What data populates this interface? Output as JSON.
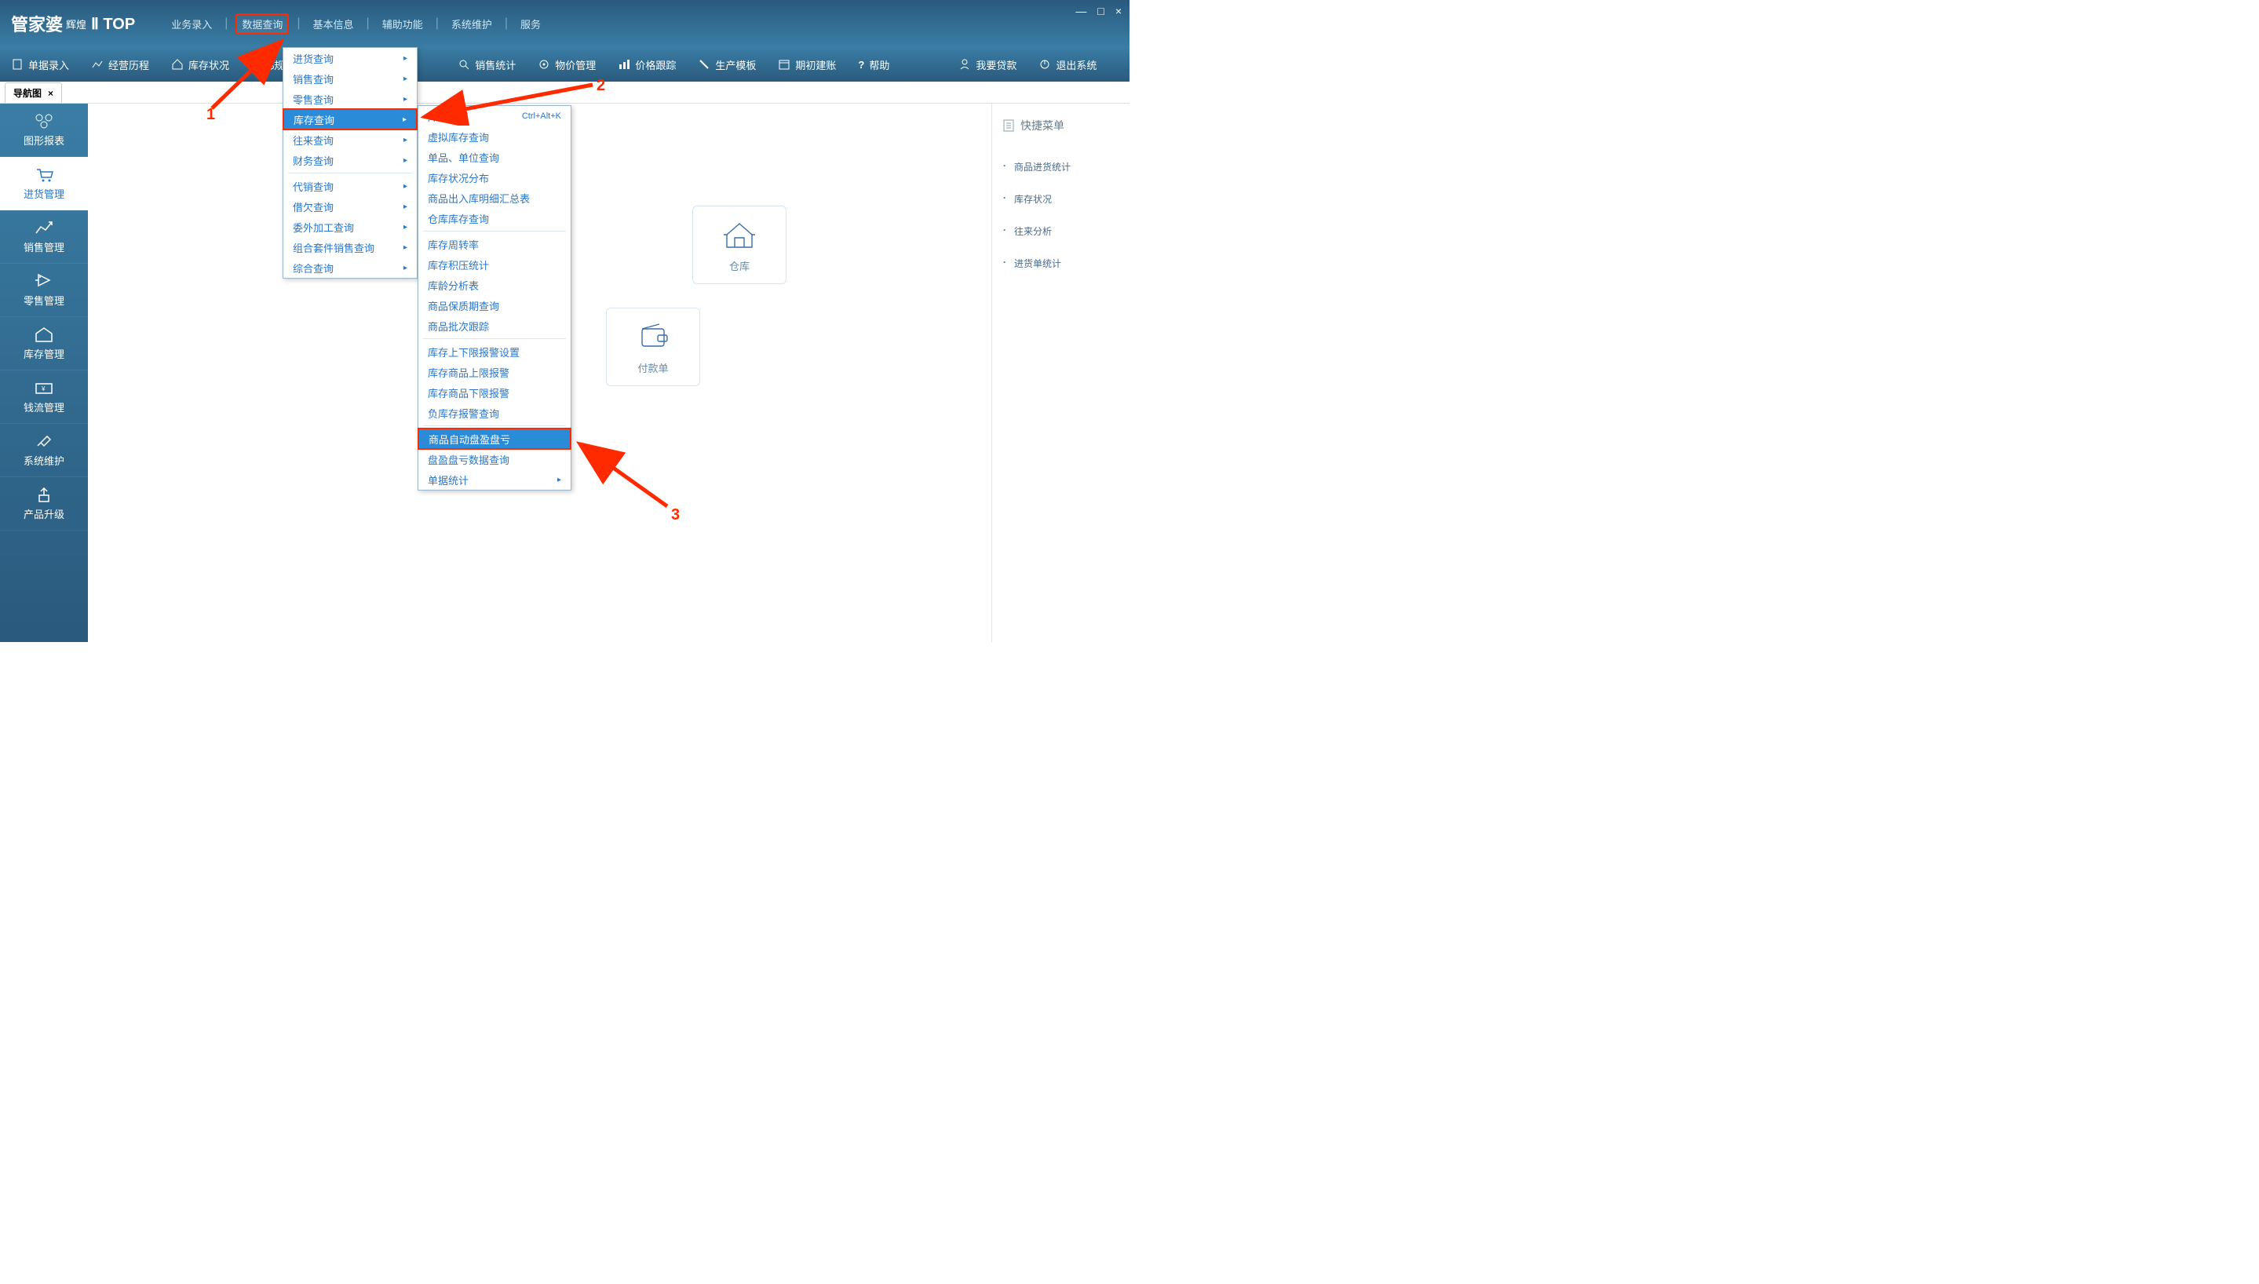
{
  "app_logo": {
    "main": "管家婆",
    "sub": "辉煌",
    "suffix": "Ⅱ TOP"
  },
  "window_controls": {
    "min": "—",
    "max": "□",
    "close": "×"
  },
  "top_menu": {
    "items": [
      "业务录入",
      "数据查询",
      "基本信息",
      "辅助功能",
      "系统维护",
      "服务"
    ],
    "highlighted_index": 1
  },
  "toolbar": [
    {
      "label": "单据录入",
      "icon": "document"
    },
    {
      "label": "经营历程",
      "icon": "chart"
    },
    {
      "label": "库存状况",
      "icon": "home"
    },
    {
      "label": "$规查",
      "icon": "dollar"
    },
    {
      "label": "销售统计",
      "icon": "search"
    },
    {
      "label": "物价管理",
      "icon": "gear"
    },
    {
      "label": "价格跟踪",
      "icon": "bars"
    },
    {
      "label": "生产模板",
      "icon": "wrench"
    },
    {
      "label": "期初建账",
      "icon": "calendar"
    },
    {
      "label": "帮助",
      "icon": "question"
    },
    {
      "label": "我要贷款",
      "icon": "person"
    },
    {
      "label": "退出系统",
      "icon": "power"
    }
  ],
  "tab": {
    "label": "导航图",
    "close": "×"
  },
  "sidebar": [
    {
      "label": "图形报表"
    },
    {
      "label": "进货管理",
      "active": true
    },
    {
      "label": "销售管理"
    },
    {
      "label": "零售管理"
    },
    {
      "label": "库存管理"
    },
    {
      "label": "钱流管理"
    },
    {
      "label": "系统维护"
    },
    {
      "label": "产品升级"
    }
  ],
  "nav_cards": {
    "warehouse": "仓库",
    "payment": "付款单"
  },
  "quick_menu": {
    "title": "快捷菜单",
    "items": [
      "商品进货统计",
      "库存状况",
      "往来分析",
      "进货单统计"
    ]
  },
  "menu1": {
    "groups": [
      [
        "进货查询",
        "销售查询",
        "零售查询",
        "库存查询",
        "往来查询",
        "财务查询"
      ],
      [
        "代销查询",
        "借欠查询",
        "委外加工查询",
        "组合套件销售查询",
        "综合查询"
      ]
    ],
    "highlighted_index": 3
  },
  "menu2": {
    "groups": [
      [
        {
          "label": "库存状况",
          "shortcut": "Ctrl+Alt+K"
        },
        {
          "label": "虚拟库存查询"
        },
        {
          "label": "单品、单位查询"
        },
        {
          "label": "库存状况分布"
        },
        {
          "label": "商品出入库明细汇总表"
        },
        {
          "label": "仓库库存查询"
        }
      ],
      [
        {
          "label": "库存周转率"
        },
        {
          "label": "库存积压统计"
        },
        {
          "label": "库龄分析表"
        },
        {
          "label": "商品保质期查询"
        },
        {
          "label": "商品批次跟踪"
        }
      ],
      [
        {
          "label": "库存上下限报警设置"
        },
        {
          "label": "库存商品上限报警"
        },
        {
          "label": "库存商品下限报警"
        },
        {
          "label": "负库存报警查询"
        }
      ],
      [
        {
          "label": "商品自动盘盈盘亏",
          "highlighted": true
        },
        {
          "label": "盘盈盘亏数据查询"
        },
        {
          "label": "单据统计",
          "has_arrow": true
        }
      ]
    ]
  },
  "annotations": {
    "n1": "1",
    "n2": "2",
    "n3": "3"
  }
}
